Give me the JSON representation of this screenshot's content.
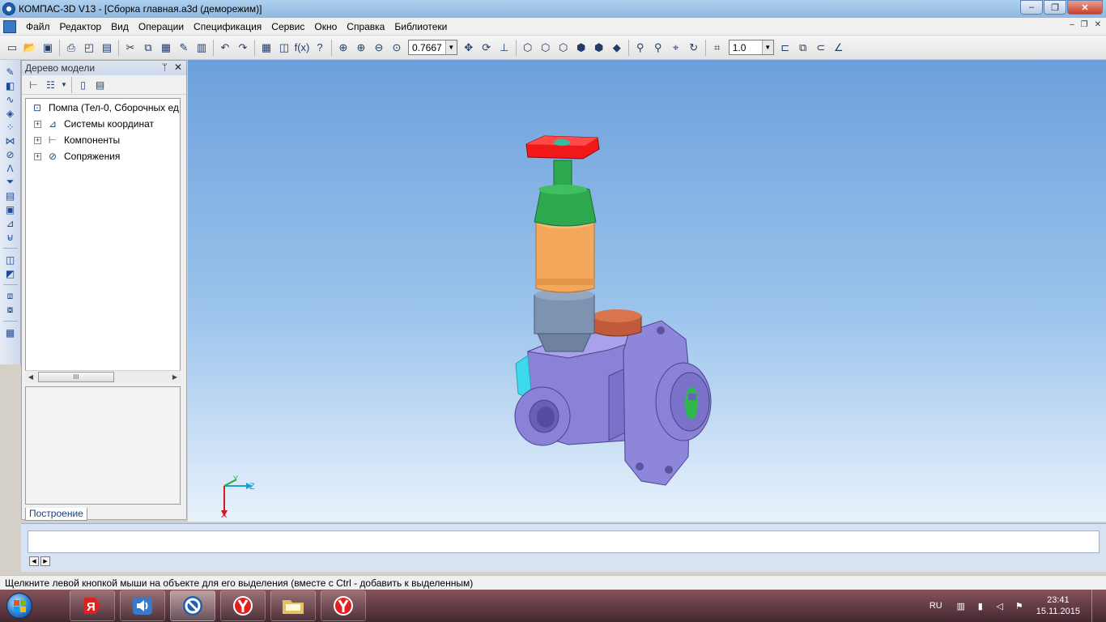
{
  "window": {
    "title": "КОМПАС-3D V13 - [Сборка главная.a3d (деморежим)]",
    "minimize": "–",
    "maximize": "❐",
    "close": "✕"
  },
  "menu": {
    "items": [
      "Файл",
      "Редактор",
      "Вид",
      "Операции",
      "Спецификация",
      "Сервис",
      "Окно",
      "Справка",
      "Библиотеки"
    ],
    "mdi": [
      "–",
      "❐",
      "✕"
    ]
  },
  "toolbar": {
    "zoom_value": "0.7667",
    "step_value": "1.0",
    "fx_label": "f(x)"
  },
  "tree": {
    "header": "Дерево модели",
    "pin": "ᛘ",
    "close": "✕",
    "root": "Помпа (Тел-0, Сборочных ед",
    "children": [
      "Системы координат",
      "Компоненты",
      "Сопряжения"
    ],
    "tab": "Построение",
    "expander": "+",
    "scroll_thumb": "III"
  },
  "axes": {
    "x": "X",
    "y": "Y",
    "z": "Z"
  },
  "status": {
    "text": "Щелкните левой кнопкой мыши на объекте для его выделения (вместе с Ctrl - добавить к выделенным)"
  },
  "taskbar": {
    "lang": "RU",
    "time": "23:41",
    "date": "15.11.2015"
  },
  "colors": {
    "handwheel": "#f01818",
    "stem": "#2da84e",
    "spring_housing": "#f4a85c",
    "nut": "#7e93b2",
    "body": "#8a82d6",
    "plug": "#c05a3a"
  }
}
